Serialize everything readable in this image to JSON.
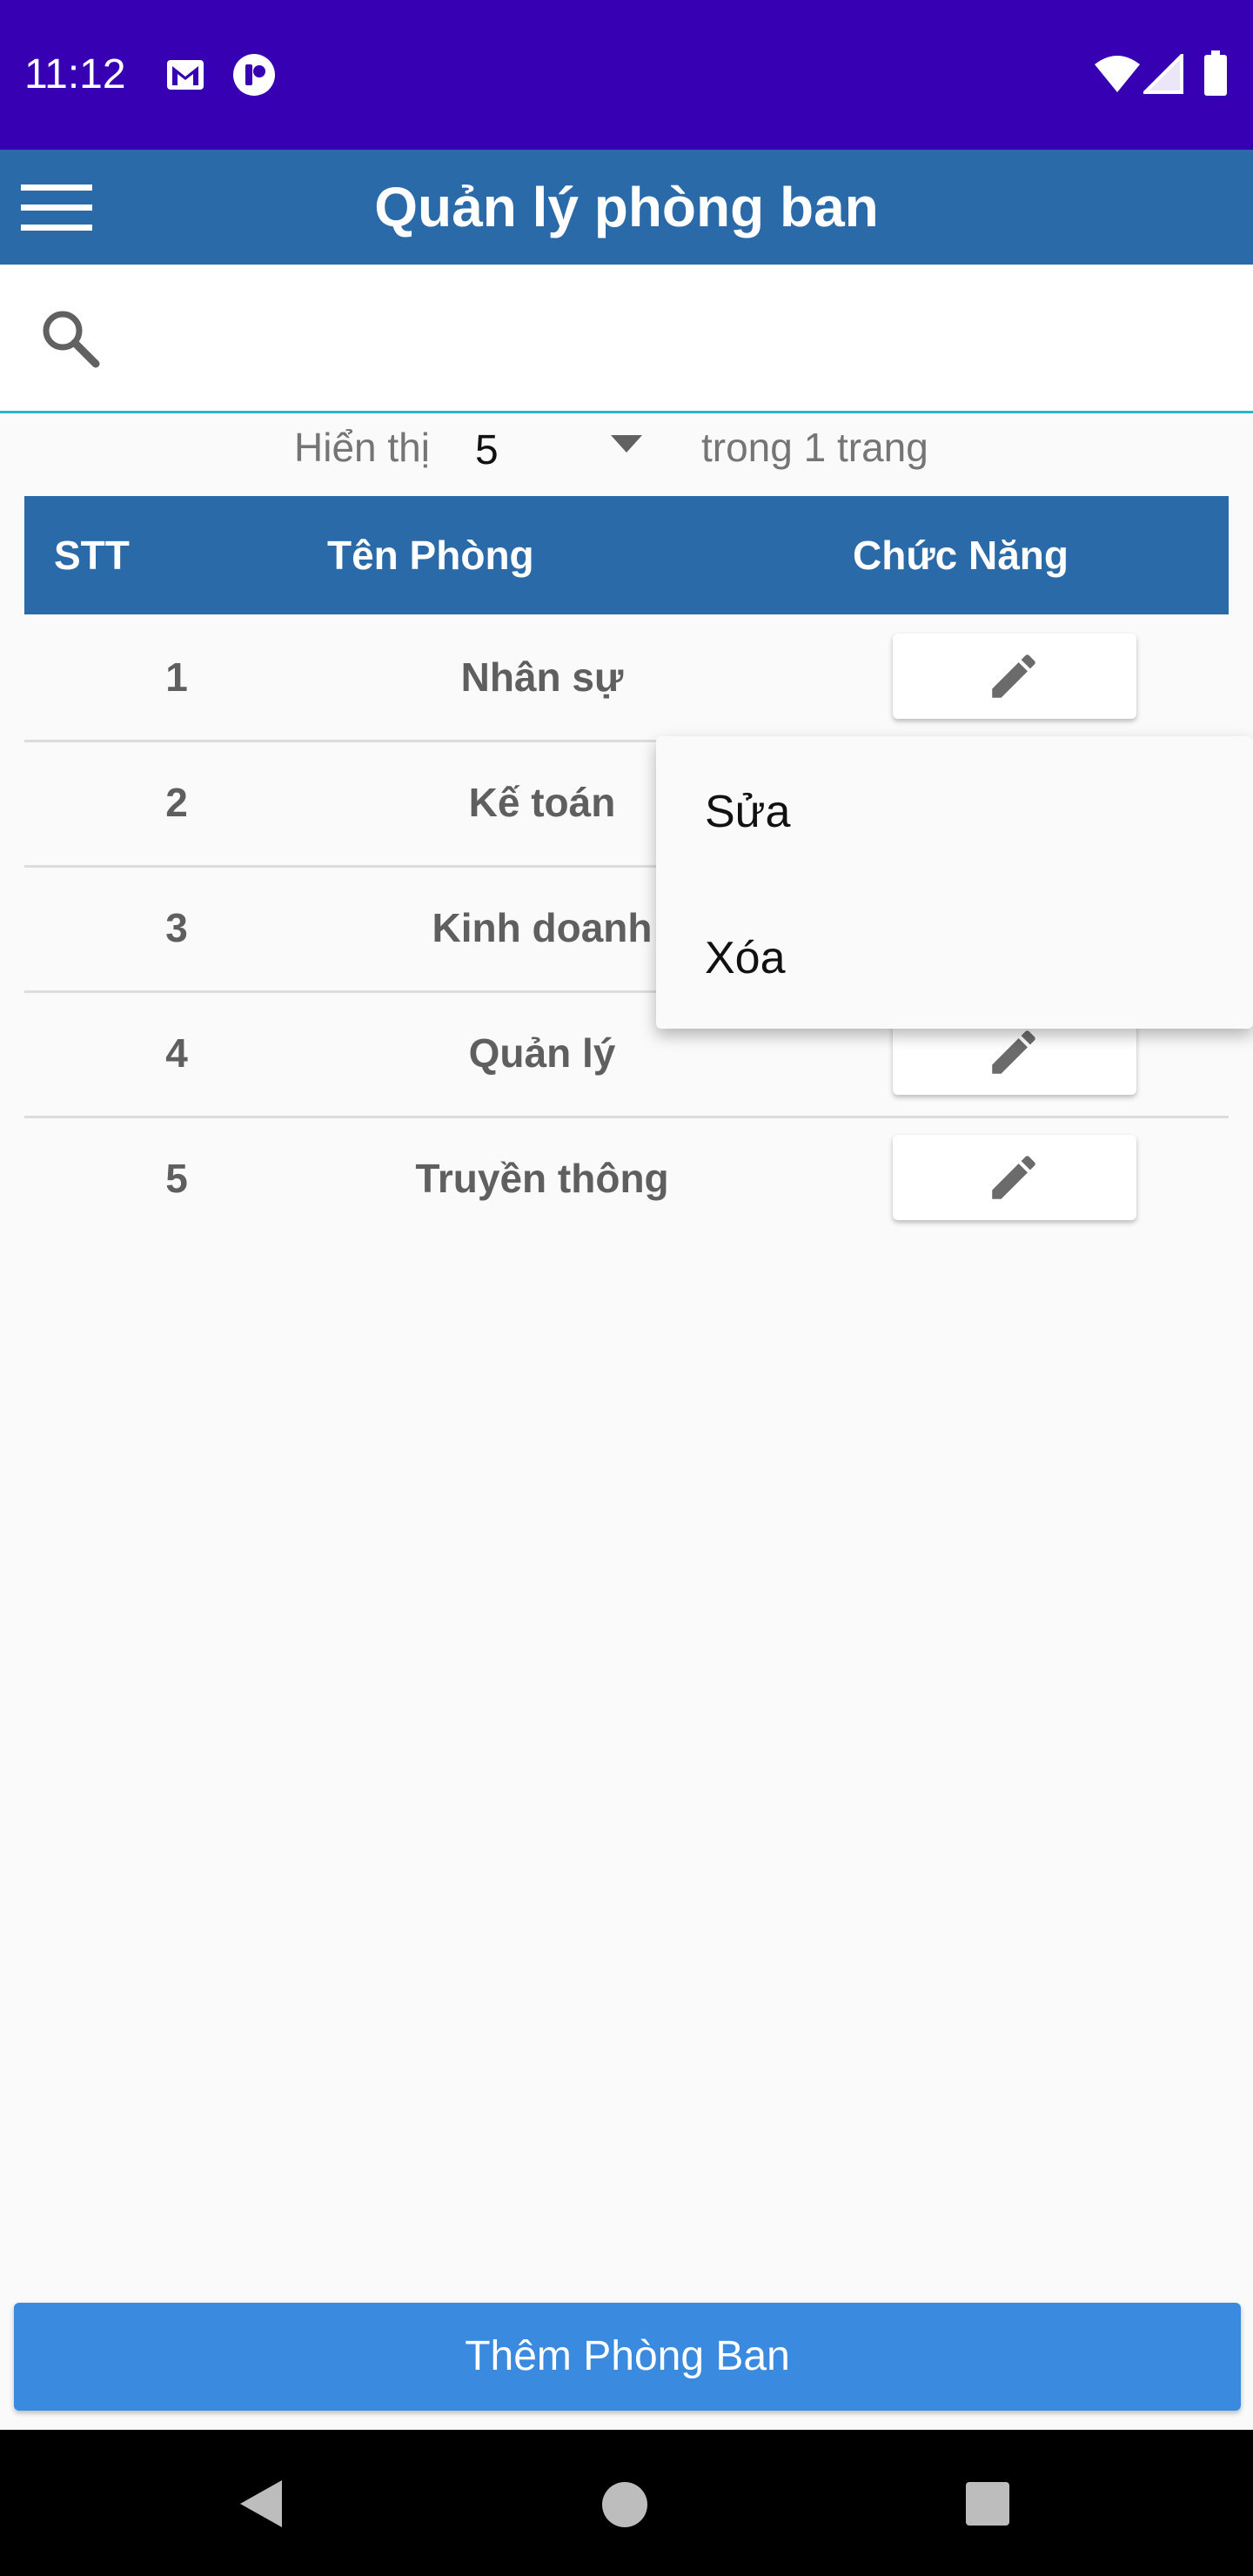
{
  "status_bar": {
    "time": "11:12",
    "icons": [
      "gmail-icon",
      "app-notification-icon",
      "wifi-icon",
      "signal-icon",
      "battery-icon"
    ],
    "background": "#3700b3"
  },
  "app_bar": {
    "title": "Quản lý phòng ban",
    "background": "#2a6aa8",
    "menu_icon": "hamburger-menu-icon"
  },
  "search": {
    "value": "",
    "placeholder": "",
    "icon": "search-icon"
  },
  "pagination": {
    "show_label": "Hiển thị",
    "page_size": "5",
    "pages_label": "trong 1 trang"
  },
  "table": {
    "headers": [
      "STT",
      "Tên Phòng",
      "Chức Năng"
    ],
    "rows": [
      {
        "stt": "1",
        "name": "Nhân sự"
      },
      {
        "stt": "2",
        "name": "Kế toán"
      },
      {
        "stt": "3",
        "name": "Kinh doanh"
      },
      {
        "stt": "4",
        "name": "Quản lý"
      },
      {
        "stt": "5",
        "name": "Truyền thông"
      }
    ],
    "action_icon": "pencil-edit-icon"
  },
  "popup_menu": {
    "items": [
      "Sửa",
      "Xóa"
    ]
  },
  "add_button": {
    "label": "Thêm Phòng Ban",
    "background": "#3a8ae0"
  },
  "nav_bar": {
    "icons": [
      "back-icon",
      "home-icon",
      "recents-icon"
    ]
  }
}
